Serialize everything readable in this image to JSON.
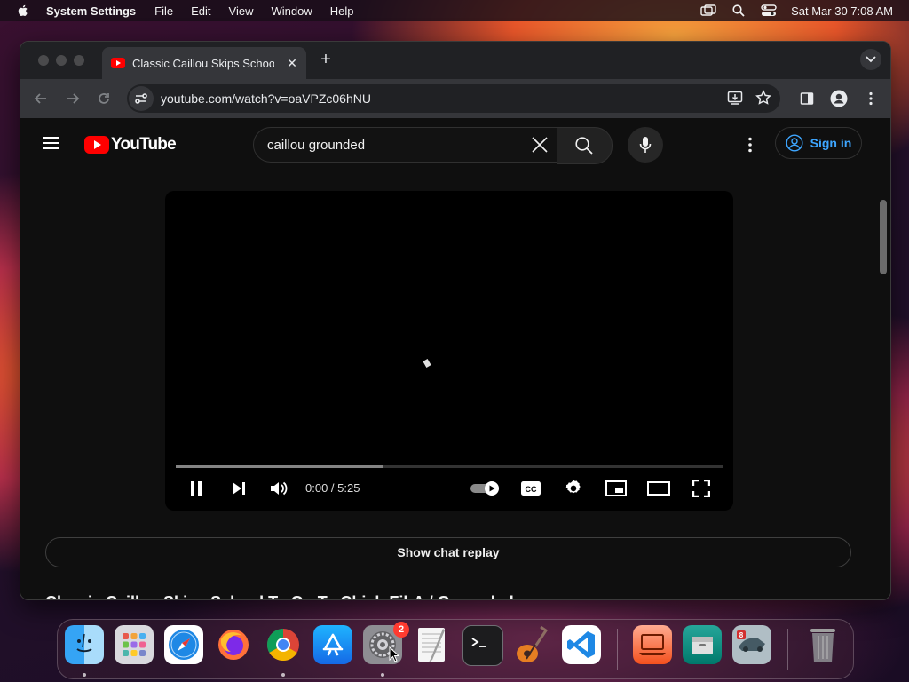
{
  "menubar": {
    "app_name": "System Settings",
    "items": [
      "File",
      "Edit",
      "View",
      "Window",
      "Help"
    ],
    "clock": "Sat Mar 30  7:08 AM",
    "status_icons": [
      "screen-mirroring-icon",
      "spotlight-search-icon",
      "control-center-icon"
    ]
  },
  "browser": {
    "tab_title": "Classic Caillou Skips School T",
    "url": "youtube.com/watch?v=oaVPZc06hNU",
    "toolbar_icons": [
      "back-icon",
      "forward-icon",
      "reload-icon",
      "site-info-icon",
      "install-app-icon",
      "bookmark-star-icon",
      "side-panel-icon",
      "profile-icon",
      "chrome-menu-icon"
    ]
  },
  "youtube": {
    "logo_text": "YouTube",
    "search_query": "caillou grounded",
    "sign_in_label": "Sign in",
    "player": {
      "time": "0:00 / 5:25",
      "buffered_fraction": 0.38,
      "cc_label": "CC"
    },
    "show_chat_label": "Show chat replay",
    "video_title_partial": "Classic Caillou Skips School To Go To Chick-Fil-A / Grounded"
  },
  "dock": {
    "apps": [
      "Finder",
      "Launchpad",
      "Safari",
      "Firefox",
      "Google Chrome",
      "App Store",
      "System Settings",
      "TextEdit",
      "Terminal",
      "GarageBand",
      "Visual Studio Code",
      "Remote Desktop",
      "Archive Utility",
      "Photo Booth",
      "Trash"
    ],
    "settings_badge": "2"
  },
  "colors": {
    "yt_red": "#ff0000",
    "link_blue": "#3ea6ff",
    "page_bg": "#0f0f0f"
  }
}
